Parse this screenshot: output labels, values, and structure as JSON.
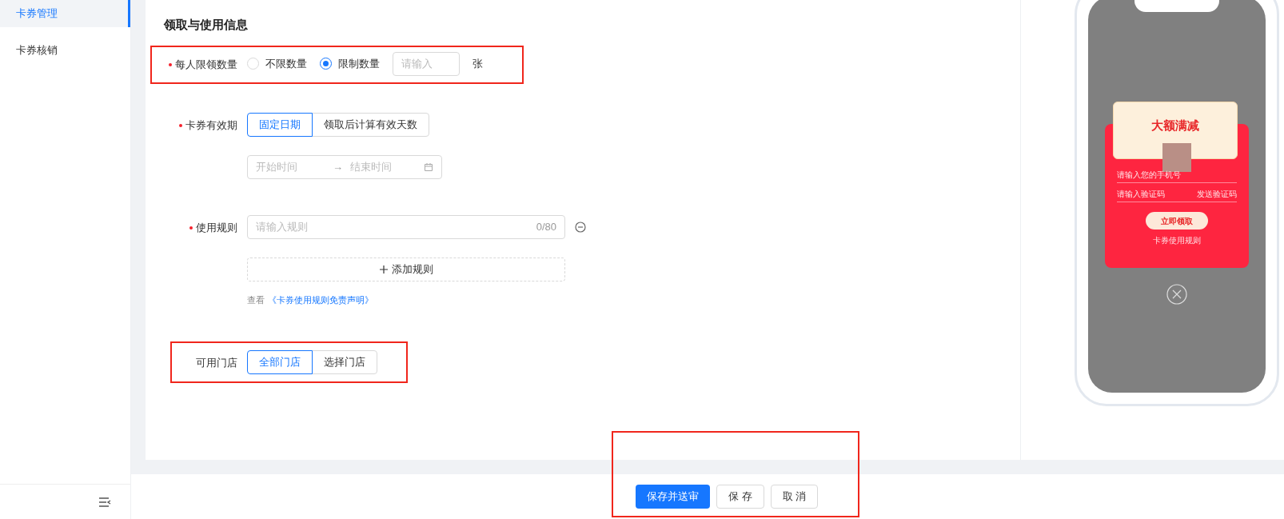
{
  "sidebar": {
    "items": [
      {
        "label": "卡券管理",
        "selected": true
      },
      {
        "label": "卡券核销",
        "selected": false
      }
    ]
  },
  "section_title": "领取与使用信息",
  "form": [
    {
      "kind": "radio",
      "label": "每人限领数量",
      "required": true,
      "highlighted": true,
      "options": [
        {
          "label": "不限数量",
          "selected": false
        },
        {
          "label": "限制数量",
          "selected": true
        }
      ],
      "input": {
        "placeholder": "请输入"
      },
      "unit": "张"
    },
    {
      "kind": "segmented",
      "label": "卡券有效期",
      "required": true,
      "highlighted": false,
      "options": [
        {
          "label": "固定日期",
          "selected": true
        },
        {
          "label": "领取后计算有效天数",
          "selected": false
        }
      ],
      "date_range": {
        "start_placeholder": "开始时间",
        "separator": "→",
        "end_placeholder": "结束时间"
      }
    },
    {
      "kind": "rules",
      "label": "使用规则",
      "required": true,
      "highlighted": false,
      "input": {
        "placeholder": "请输入规则",
        "counter": "0/80"
      },
      "add_button": "添加规则",
      "note": "查看",
      "link": "《卡券使用规则免责声明》"
    },
    {
      "kind": "segmented",
      "label": "可用门店",
      "required": false,
      "highlighted": true,
      "options": [
        {
          "label": "全部门店",
          "selected": true
        },
        {
          "label": "选择门店",
          "selected": false
        }
      ]
    }
  ],
  "preview": {
    "title": "大额满减",
    "phone_placeholder": "请输入您的手机号",
    "code_placeholder": "请输入验证码",
    "send_code": "发送验证码",
    "claim_button": "立即领取",
    "rules_link": "卡券使用规则"
  },
  "footer": {
    "highlighted": true,
    "buttons": [
      {
        "label": "保存并送审",
        "kind": "primary"
      },
      {
        "label": "保 存",
        "kind": "default"
      },
      {
        "label": "取 消",
        "kind": "default"
      }
    ]
  }
}
